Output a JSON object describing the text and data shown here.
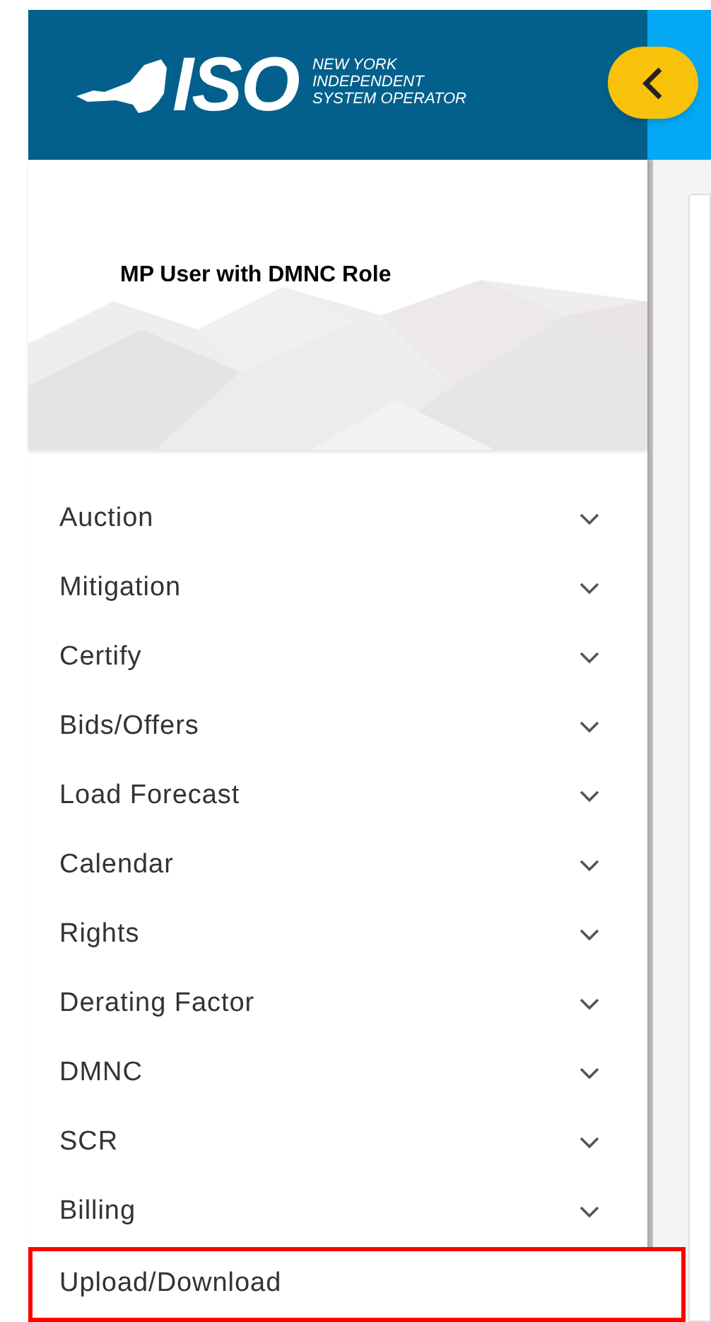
{
  "header": {
    "logo": {
      "mark": "ISO",
      "lines": [
        "NEW YORK",
        "INDEPENDENT",
        "SYSTEM OPERATOR"
      ]
    }
  },
  "profile": {
    "title": "MP User with DMNC Role"
  },
  "menu": [
    {
      "label": "Auction",
      "expandable": true,
      "highlighted": false
    },
    {
      "label": "Mitigation",
      "expandable": true,
      "highlighted": false
    },
    {
      "label": "Certify",
      "expandable": true,
      "highlighted": false
    },
    {
      "label": "Bids/Offers",
      "expandable": true,
      "highlighted": false
    },
    {
      "label": "Load Forecast",
      "expandable": true,
      "highlighted": false
    },
    {
      "label": "Calendar",
      "expandable": true,
      "highlighted": false
    },
    {
      "label": "Rights",
      "expandable": true,
      "highlighted": false
    },
    {
      "label": "Derating Factor",
      "expandable": true,
      "highlighted": false
    },
    {
      "label": "DMNC",
      "expandable": true,
      "highlighted": false
    },
    {
      "label": "SCR",
      "expandable": true,
      "highlighted": false
    },
    {
      "label": "Billing",
      "expandable": true,
      "highlighted": false
    },
    {
      "label": "Upload/Download",
      "expandable": false,
      "highlighted": true
    }
  ]
}
